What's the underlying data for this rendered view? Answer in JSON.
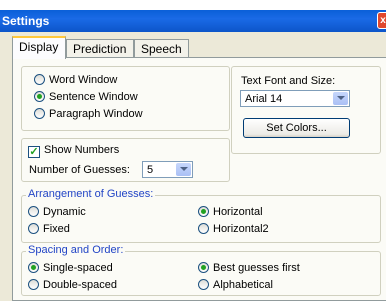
{
  "window": {
    "title": "Settings",
    "close_glyph": "x"
  },
  "tabs": [
    {
      "label": "Display",
      "active": true
    },
    {
      "label": "Prediction",
      "active": false
    },
    {
      "label": "Speech",
      "active": false
    }
  ],
  "window_type": {
    "options": [
      {
        "label": "Word Window",
        "selected": false
      },
      {
        "label": "Sentence Window",
        "selected": true
      },
      {
        "label": "Paragraph Window",
        "selected": false
      }
    ]
  },
  "font": {
    "label": "Text Font and Size:",
    "value": "Arial 14",
    "set_colors_label": "Set Colors..."
  },
  "numbers": {
    "show_label": "Show Numbers",
    "show_checked": true,
    "guesses_label": "Number of Guesses:",
    "guesses_value": "5"
  },
  "arrangement": {
    "legend": "Arrangement of Guesses:",
    "options": [
      {
        "label": "Dynamic",
        "selected": false
      },
      {
        "label": "Fixed",
        "selected": false
      },
      {
        "label": "Horizontal",
        "selected": true
      },
      {
        "label": "Horizontal2",
        "selected": false
      }
    ]
  },
  "spacing": {
    "legend": "Spacing and Order:",
    "options": [
      {
        "label": "Single-spaced",
        "selected": true
      },
      {
        "label": "Double-spaced",
        "selected": false
      },
      {
        "label": "Best guesses first",
        "selected": true
      },
      {
        "label": "Alphabetical",
        "selected": false
      }
    ]
  },
  "colors": {
    "legend_text": "#2245c6",
    "radio_dot": "#21a121",
    "titlebar": "#0a5fd8"
  }
}
